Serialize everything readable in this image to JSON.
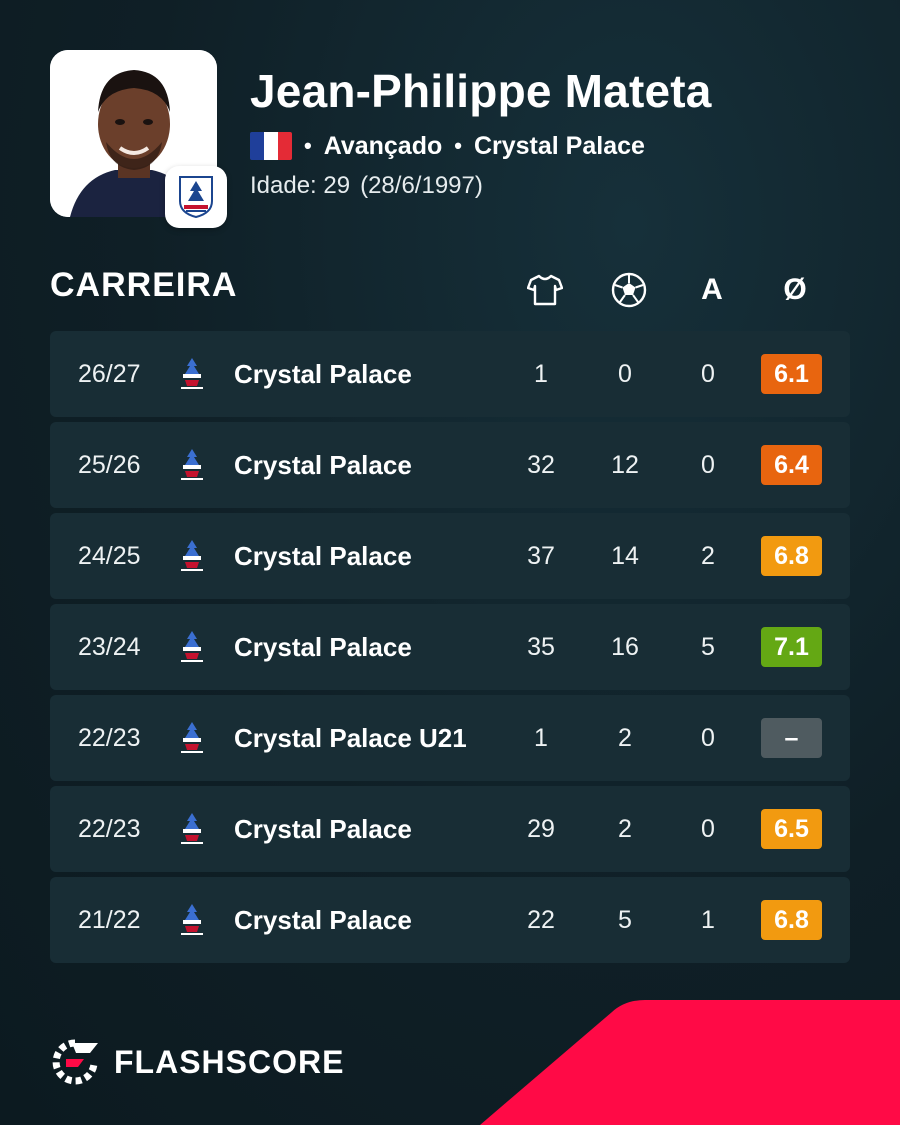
{
  "player": {
    "name": "Jean-Philippe Mateta",
    "position": "Avançado",
    "club": "Crystal Palace",
    "age_label": "Idade: 29",
    "birth_date": "(28/6/1997)",
    "nationality_flag": "france-flag"
  },
  "section": {
    "title": "CARREIRA",
    "columns": [
      {
        "icon": "jersey-icon",
        "meaning": "appearances"
      },
      {
        "icon": "football-icon",
        "meaning": "goals"
      },
      {
        "label": "A",
        "meaning": "assists"
      },
      {
        "label": "Ø",
        "meaning": "average rating"
      }
    ]
  },
  "career": [
    {
      "season": "26/27",
      "team": "Crystal Palace",
      "apps": "1",
      "goals": "0",
      "assists": "0",
      "rating": "6.1",
      "rating_color": "#e8650f"
    },
    {
      "season": "25/26",
      "team": "Crystal Palace",
      "apps": "32",
      "goals": "12",
      "assists": "0",
      "rating": "6.4",
      "rating_color": "#e8650f"
    },
    {
      "season": "24/25",
      "team": "Crystal Palace",
      "apps": "37",
      "goals": "14",
      "assists": "2",
      "rating": "6.8",
      "rating_color": "#f29a10"
    },
    {
      "season": "23/24",
      "team": "Crystal Palace",
      "apps": "35",
      "goals": "16",
      "assists": "5",
      "rating": "7.1",
      "rating_color": "#64a814"
    },
    {
      "season": "22/23",
      "team": "Crystal Palace U21",
      "apps": "1",
      "goals": "2",
      "assists": "0",
      "rating": "–",
      "rating_color": "#4f5b60"
    },
    {
      "season": "22/23",
      "team": "Crystal Palace",
      "apps": "29",
      "goals": "2",
      "assists": "0",
      "rating": "6.5",
      "rating_color": "#f29a10"
    },
    {
      "season": "21/22",
      "team": "Crystal Palace",
      "apps": "22",
      "goals": "5",
      "assists": "1",
      "rating": "6.8",
      "rating_color": "#f29a10"
    }
  ],
  "brand": {
    "name": "FLASHSCORE"
  },
  "colors": {
    "background": "#0f1f26",
    "row": "#182d35",
    "accent_red": "#ff0a46"
  }
}
